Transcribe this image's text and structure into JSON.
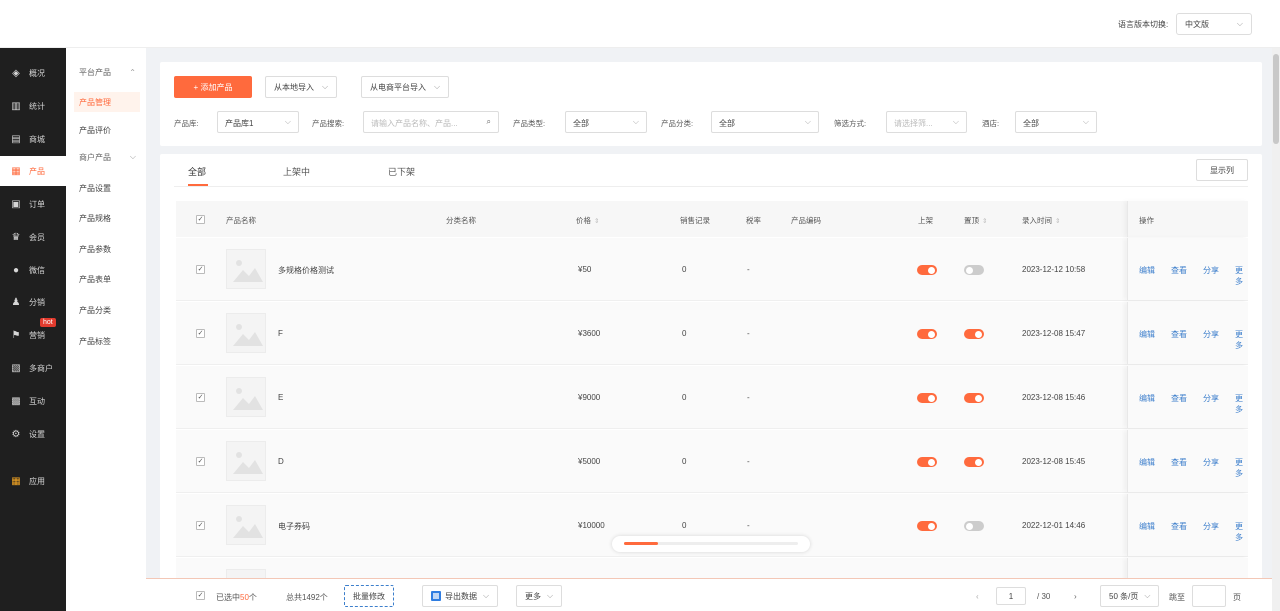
{
  "header": {
    "lang_label": "语言版本切换:",
    "lang_value": "中文版"
  },
  "sidebar": {
    "items": [
      {
        "label": "概况",
        "icon": "layers-icon"
      },
      {
        "label": "统计",
        "icon": "chart-icon"
      },
      {
        "label": "商城",
        "icon": "store-icon"
      },
      {
        "label": "产品",
        "icon": "grid-icon"
      },
      {
        "label": "订单",
        "icon": "order-icon"
      },
      {
        "label": "会员",
        "icon": "crown-icon"
      },
      {
        "label": "微信",
        "icon": "wechat-icon"
      },
      {
        "label": "分销",
        "icon": "distribution-icon"
      },
      {
        "label": "营销",
        "icon": "flag-icon"
      },
      {
        "label": "多商户",
        "icon": "merchant-icon"
      },
      {
        "label": "互动",
        "icon": "interact-icon"
      },
      {
        "label": "设置",
        "icon": "gear-icon"
      },
      {
        "label": "应用",
        "icon": "apps-icon"
      }
    ],
    "hot_badge": "hot"
  },
  "subnav": {
    "group1": "平台产品",
    "items1": [
      "产品管理",
      "产品评价"
    ],
    "group2": "商户产品",
    "items2": [
      "产品设置",
      "产品规格",
      "产品参数",
      "产品表单",
      "产品分类",
      "产品标签"
    ]
  },
  "toolbar": {
    "add_product": "+ 添加产品",
    "import_local": "从本地导入",
    "import_platform": "从电商平台导入"
  },
  "filters": {
    "library_label": "产品库:",
    "library_value": "产品库1",
    "search_label": "产品搜索:",
    "search_placeholder": "请输入产品名称、产品...",
    "type_label": "产品类型:",
    "type_value": "全部",
    "category_label": "产品分类:",
    "category_value": "全部",
    "filter_label": "筛选方式:",
    "filter_placeholder": "请选择筛...",
    "store_label": "酒店:",
    "store_value": "全部"
  },
  "tabs": [
    "全部",
    "上架中",
    "已下架"
  ],
  "display_columns": "显示列",
  "table": {
    "headers": {
      "name": "产品名称",
      "category": "分类名称",
      "price": "价格",
      "sales": "销售记录",
      "tax": "税率",
      "code": "产品编码",
      "listed": "上架",
      "pinned": "置顶",
      "created": "录入时间",
      "actions": "操作"
    },
    "rows": [
      {
        "name": "多规格价格测试",
        "price": "¥50",
        "sales": "0",
        "tax": "-",
        "created": "2023-12-12 10:58"
      },
      {
        "name": "F",
        "price": "¥3600",
        "sales": "0",
        "tax": "-",
        "created": "2023-12-08 15:47"
      },
      {
        "name": "E",
        "price": "¥9000",
        "sales": "0",
        "tax": "-",
        "created": "2023-12-08 15:46"
      },
      {
        "name": "D",
        "price": "¥5000",
        "sales": "0",
        "tax": "-",
        "created": "2023-12-08 15:45"
      },
      {
        "name": "电子券码",
        "price": "¥10000",
        "sales": "0",
        "tax": "-",
        "created": "2022-12-01 14:46"
      }
    ],
    "actions": [
      "编辑",
      "查看",
      "分享",
      "更多"
    ]
  },
  "bottom": {
    "selected_prefix": "已选中",
    "selected_count": "50",
    "selected_suffix": "个",
    "total": "总共1492个",
    "batch_edit": "批量修改",
    "export": "导出数据",
    "more": "更多",
    "page_current": "1",
    "page_total": "/ 30",
    "page_size": "50 条/页",
    "jump_label": "跳至",
    "page_unit": "页"
  },
  "colors": {
    "accent": "#ff6a3d",
    "link": "#3d7fcc",
    "sidebar_bg": "#1f1f1f"
  }
}
